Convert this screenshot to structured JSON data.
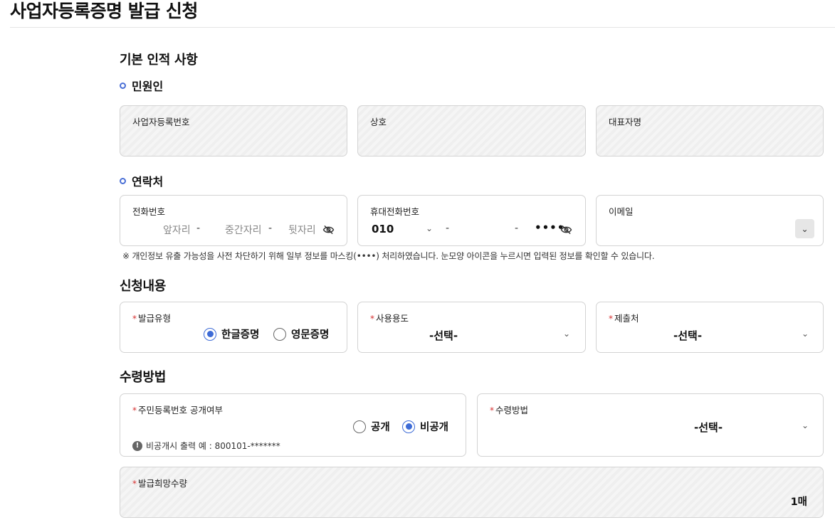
{
  "page": {
    "title": "사업자등록증명 발급 신청"
  },
  "basic": {
    "title": "기본 인적 사항",
    "applicant": {
      "title": "민원인",
      "business_no_label": "사업자등록번호",
      "company_label": "상호",
      "rep_label": "대표자명"
    },
    "contact": {
      "title": "연락처",
      "phone_label": "전화번호",
      "phone_first_ph": "앞자리",
      "phone_mid_ph": "중간자리",
      "phone_last_ph": "뒷자리",
      "mobile_label": "휴대전화번호",
      "mobile_prefix": "010",
      "mobile_masked": "••••",
      "email_label": "이메일",
      "dash": "-"
    },
    "notice": "※ 개인정보 유출 가능성을 사전 차단하기 위해 일부 정보를 마스킹(••••) 처리하였습니다. 눈모양 아이콘을 누르시면 입력된 정보를 확인할 수 있습니다."
  },
  "request": {
    "title": "신청내용",
    "issue_type_label": "발급유형",
    "issue_type_options": [
      "한글증명",
      "영문증명"
    ],
    "issue_type_selected": "한글증명",
    "purpose_label": "사용용도",
    "purpose_value": "-선택-",
    "submit_to_label": "제출처",
    "submit_to_value": "-선택-"
  },
  "receive": {
    "title": "수령방법",
    "rrn_label": "주민등록번호 공개여부",
    "rrn_options": [
      "공개",
      "비공개"
    ],
    "rrn_selected": "비공개",
    "rrn_info": "비공개시 출력 예 : 800101-*******",
    "method_label": "수령방법",
    "method_value": "-선택-",
    "quantity_label": "발급희망수량",
    "quantity_value": "1매"
  },
  "required_mark": "*",
  "icons": {
    "eye_off": "eye-slash-icon",
    "chevron": "chevron-down-icon",
    "info": "info-icon"
  }
}
